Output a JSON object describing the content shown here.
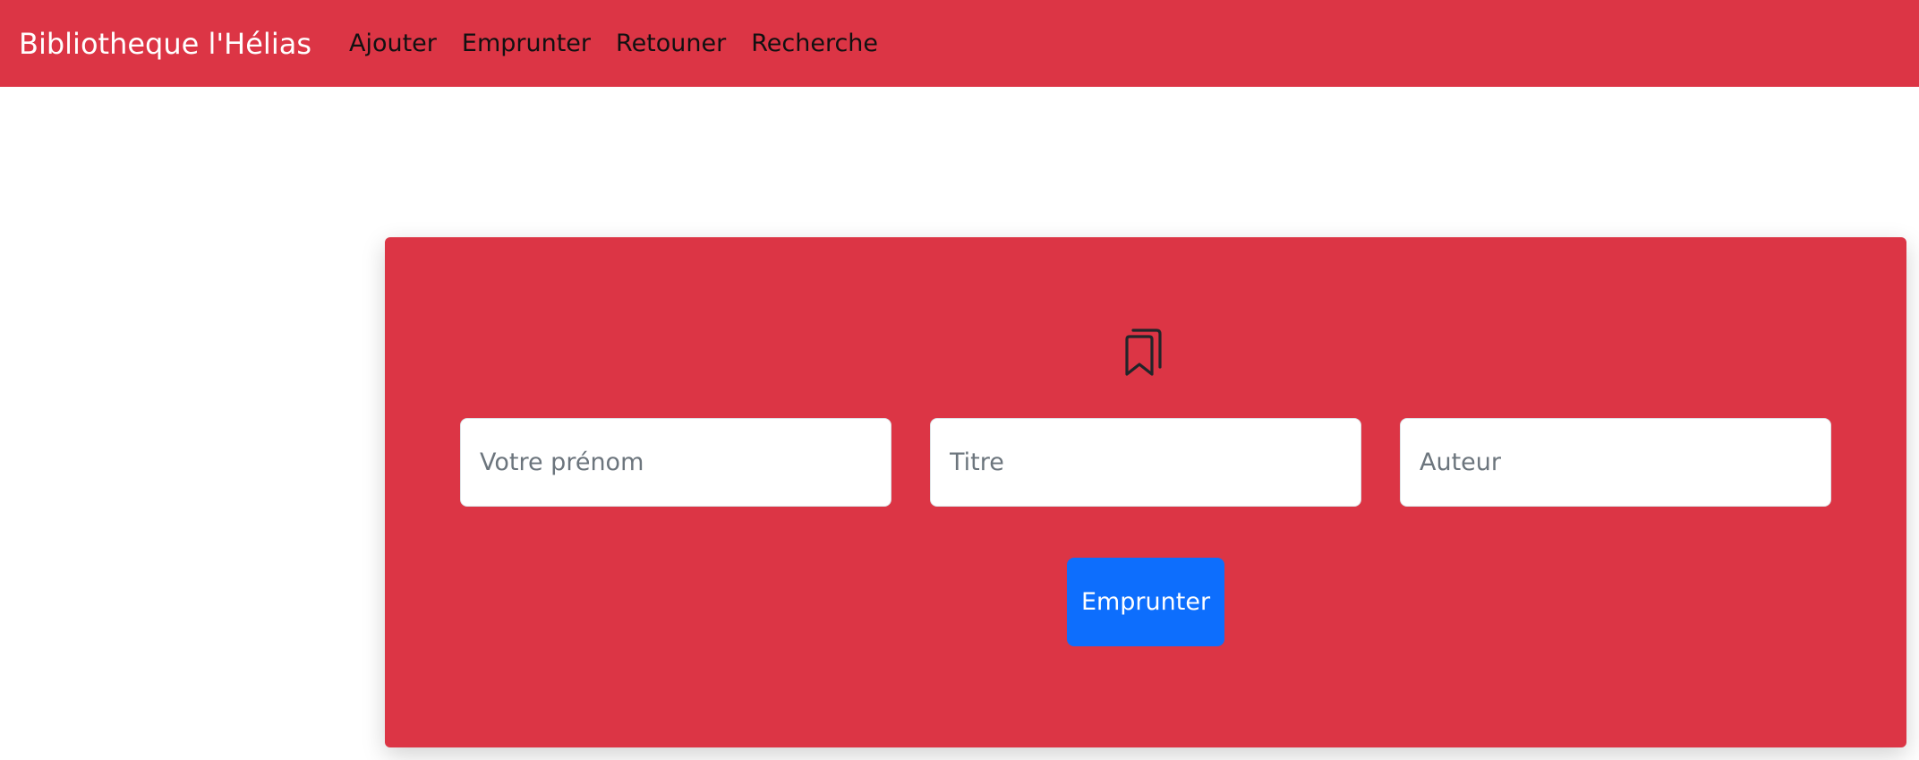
{
  "navbar": {
    "brand": "Bibliotheque l'Hélias",
    "links": [
      {
        "label": "Ajouter"
      },
      {
        "label": "Emprunter"
      },
      {
        "label": "Retouner"
      },
      {
        "label": "Recherche"
      }
    ],
    "background_color": "#dc3545"
  },
  "form": {
    "icon": "bookmarks-icon",
    "fields": {
      "prenom": {
        "placeholder": "Votre prénom",
        "value": ""
      },
      "titre": {
        "placeholder": "Titre",
        "value": ""
      },
      "auteur": {
        "placeholder": "Auteur",
        "value": ""
      }
    },
    "submit_label": "Emprunter",
    "card_color": "#dc3545",
    "button_color": "#0d6efd"
  }
}
